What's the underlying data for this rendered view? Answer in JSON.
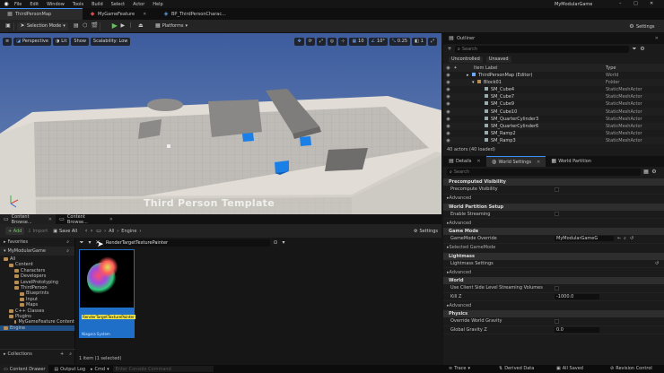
{
  "app": {
    "title": "MyModularGame"
  },
  "menu": [
    "File",
    "Edit",
    "Window",
    "Tools",
    "Build",
    "Select",
    "Actor",
    "Help"
  ],
  "tabs": [
    {
      "label": "ThirdPersonMap",
      "active": true
    },
    {
      "label": "MyGameFeature",
      "active": false
    },
    {
      "label": "BP_ThirdPersonCharac...",
      "active": false
    }
  ],
  "toolbar": {
    "selection_mode": "Selection Mode",
    "platforms": "Platforms",
    "settings": "Settings"
  },
  "viewport": {
    "perspective": "Perspective",
    "lit": "Lit",
    "show": "Show",
    "scalability": "Scalability: Low",
    "grid": "10",
    "angle": "10°",
    "scale": "0.25",
    "cam_speed": "1",
    "watermark": "Third Person Template"
  },
  "content_browser": {
    "tabs": [
      "Content Browse...",
      "Content Browse..."
    ],
    "add": "+ Add",
    "import": "Import",
    "save_all": "Save All",
    "path": [
      "All",
      "Engine"
    ],
    "settings": "Settings",
    "favorites": "Favorites",
    "root": "MyModularGame",
    "tree": [
      "All",
      "Content",
      "Characters",
      "Developers",
      "LevelPrototyping",
      "ThirdPerson",
      "Blueprints",
      "Input",
      "Maps",
      "C++ Classes",
      "Plugins",
      "MyGameFeature Content",
      "Engine"
    ],
    "collections": "Collections",
    "search_value": "RenderTargetTexturePainter",
    "asset": {
      "name": "RenderTargetTexturePainter",
      "type": "Niagara System"
    },
    "count": "1 item (1 selected)"
  },
  "outliner": {
    "title": "Outliner",
    "search_placeholder": "Search",
    "filters": [
      "Uncontrolled",
      "Unsaved"
    ],
    "cols": [
      "Item Label",
      "Type"
    ],
    "rows": [
      {
        "label": "ThirdPersonMap (Editor)",
        "type": "World"
      },
      {
        "label": "Block01",
        "type": "Folder"
      },
      {
        "label": "SM_Cube4",
        "type": "StaticMeshActor"
      },
      {
        "label": "SM_Cube7",
        "type": "StaticMeshActor"
      },
      {
        "label": "SM_Cube9",
        "type": "StaticMeshActor"
      },
      {
        "label": "SM_Cube10",
        "type": "StaticMeshActor"
      },
      {
        "label": "SM_QuarterCylinder3",
        "type": "StaticMeshActor"
      },
      {
        "label": "SM_QuarterCylinder6",
        "type": "StaticMeshActor"
      },
      {
        "label": "SM_Ramp2",
        "type": "StaticMeshActor"
      },
      {
        "label": "SM_Ramp3",
        "type": "StaticMeshActor"
      }
    ],
    "count": "40 actors (40 loaded)"
  },
  "details": {
    "tabs": [
      "Details",
      "World Settings",
      "World Partition"
    ],
    "search_placeholder": "Search",
    "sections": [
      {
        "title": "Precomputed Visibility",
        "props": [
          "Precompute Visibility"
        ],
        "advanced": "Advanced"
      },
      {
        "title": "World Partition Setup",
        "props": [
          "Enable Streaming"
        ],
        "advanced": "Advanced"
      },
      {
        "title": "Game Mode",
        "props": [
          "GameMode Override"
        ],
        "sub": "Selected GameMode"
      },
      {
        "title": "Lightmass",
        "props": [
          "Lightmass Settings"
        ],
        "advanced": "Advanced"
      },
      {
        "title": "World",
        "props": [
          "Use Client Side Level Streaming Volumes",
          "Kill Z"
        ],
        "advanced": "Advanced"
      },
      {
        "title": "Physics",
        "props": [
          "Override World Gravity",
          "Global Gravity Z"
        ]
      }
    ],
    "gamemode_value": "MyModularGameG",
    "killz_value": "-1000.0",
    "gravity_value": "0.0"
  },
  "status": {
    "content_drawer": "Content Drawer",
    "output_log": "Output Log",
    "cmd": "Cmd",
    "console_placeholder": "Enter Console Command",
    "trace": "Trace",
    "derived": "Derived Data",
    "saved": "All Saved",
    "revision": "Revision Control"
  },
  "colors": {
    "accent": "#3e8ef7",
    "selected": "#1f6fc9",
    "folder": "#b58d55",
    "sky": "#4867a6"
  }
}
